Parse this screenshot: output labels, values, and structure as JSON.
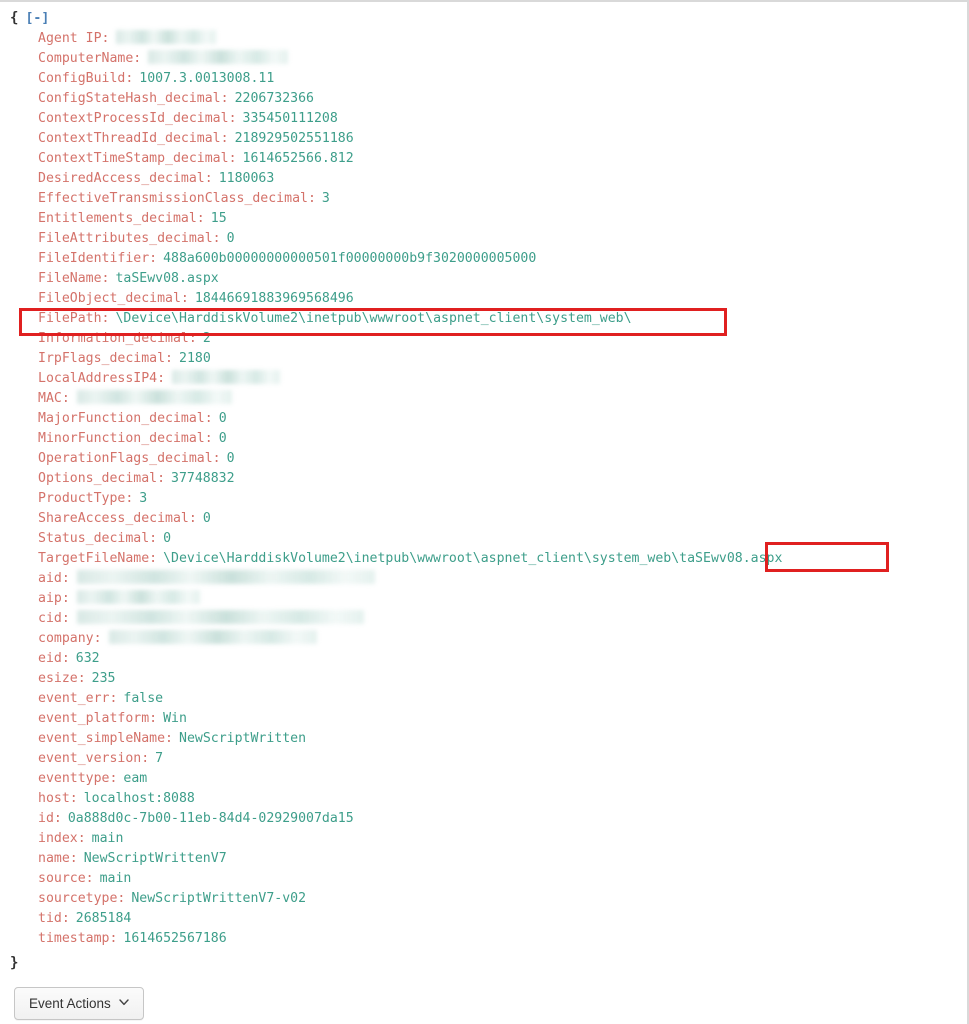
{
  "viewer": {
    "open_brace": "{",
    "close_brace": "}",
    "collapse_toggle": "[-]",
    "colon": ":"
  },
  "colors": {
    "key": "#d4726a",
    "value": "#3d9e8a",
    "toggle": "#4a7fb5",
    "highlight_box": "#e02020",
    "redaction": "#d4e6e2"
  },
  "fields": [
    {
      "key": "Agent IP",
      "value": "",
      "redacted": true,
      "redact_width": 100
    },
    {
      "key": "ComputerName",
      "value": "",
      "redacted": true,
      "redact_width": 140
    },
    {
      "key": "ConfigBuild",
      "value": "1007.3.0013008.11"
    },
    {
      "key": "ConfigStateHash_decimal",
      "value": "2206732366"
    },
    {
      "key": "ContextProcessId_decimal",
      "value": "335450111208"
    },
    {
      "key": "ContextThreadId_decimal",
      "value": "218929502551186"
    },
    {
      "key": "ContextTimeStamp_decimal",
      "value": "1614652566.812"
    },
    {
      "key": "DesiredAccess_decimal",
      "value": "1180063"
    },
    {
      "key": "EffectiveTransmissionClass_decimal",
      "value": "3"
    },
    {
      "key": "Entitlements_decimal",
      "value": "15"
    },
    {
      "key": "FileAttributes_decimal",
      "value": "0"
    },
    {
      "key": "FileIdentifier",
      "value": "488a600b00000000000501f00000000b9f3020000005000"
    },
    {
      "key": "FileName",
      "value": "taSEwv08.aspx"
    },
    {
      "key": "FileObject_decimal",
      "value": "18446691883969568496"
    },
    {
      "key": "FilePath",
      "value": "\\Device\\HarddiskVolume2\\inetpub\\wwwroot\\aspnet_client\\system_web\\",
      "highlighted": true
    },
    {
      "key": "Information_decimal",
      "value": "2"
    },
    {
      "key": "IrpFlags_decimal",
      "value": "2180"
    },
    {
      "key": "LocalAddressIP4",
      "value": "",
      "redacted": true,
      "redact_width": 108
    },
    {
      "key": "MAC",
      "value": "",
      "redacted": true,
      "redact_width": 155
    },
    {
      "key": "MajorFunction_decimal",
      "value": "0"
    },
    {
      "key": "MinorFunction_decimal",
      "value": "0"
    },
    {
      "key": "OperationFlags_decimal",
      "value": "0"
    },
    {
      "key": "Options_decimal",
      "value": "37748832"
    },
    {
      "key": "ProductType",
      "value": "3"
    },
    {
      "key": "ShareAccess_decimal",
      "value": "0"
    },
    {
      "key": "Status_decimal",
      "value": "0"
    },
    {
      "key": "TargetFileName",
      "value": "\\Device\\HarddiskVolume2\\inetpub\\wwwroot\\aspnet_client\\system_web\\taSEwv08.aspx",
      "highlighted": true
    },
    {
      "key": "aid",
      "value": "",
      "redacted": true,
      "redact_width": 298
    },
    {
      "key": "aip",
      "value": "",
      "redacted": true,
      "redact_width": 123
    },
    {
      "key": "cid",
      "value": "",
      "redacted": true,
      "redact_width": 287
    },
    {
      "key": "company",
      "value": "",
      "redacted": true,
      "redact_width": 208
    },
    {
      "key": "eid",
      "value": "632"
    },
    {
      "key": "esize",
      "value": "235"
    },
    {
      "key": "event_err",
      "value": "false"
    },
    {
      "key": "event_platform",
      "value": "Win"
    },
    {
      "key": "event_simpleName",
      "value": "NewScriptWritten"
    },
    {
      "key": "event_version",
      "value": "7"
    },
    {
      "key": "eventtype",
      "value": "eam"
    },
    {
      "key": "host",
      "value": "localhost:8088"
    },
    {
      "key": "id",
      "value": "0a888d0c-7b00-11eb-84d4-02929007da15"
    },
    {
      "key": "index",
      "value": "main"
    },
    {
      "key": "name",
      "value": "NewScriptWrittenV7"
    },
    {
      "key": "source",
      "value": "main"
    },
    {
      "key": "sourcetype",
      "value": "NewScriptWrittenV7-v02"
    },
    {
      "key": "tid",
      "value": "2685184"
    },
    {
      "key": "timestamp",
      "value": "1614652567186"
    }
  ],
  "footer": {
    "event_actions_label": "Event Actions",
    "caret_icon": "⌄"
  }
}
